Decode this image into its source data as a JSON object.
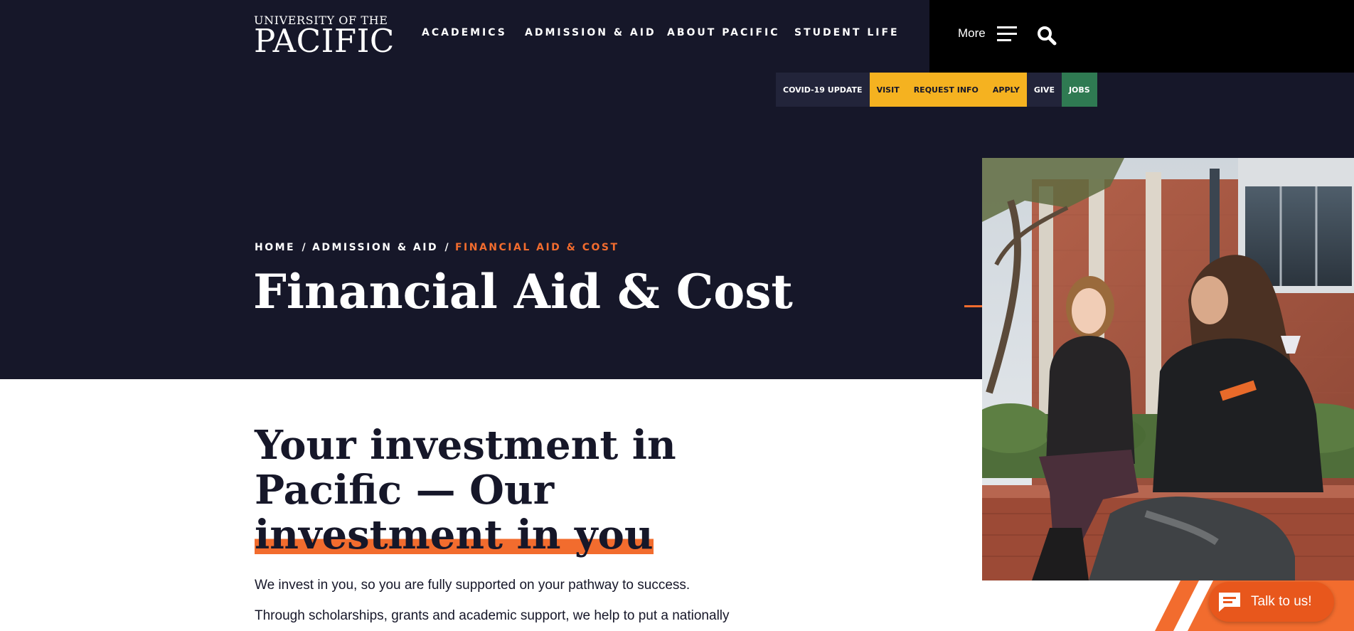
{
  "header": {
    "logo": {
      "top_line": "UNIVERSITY OF THE",
      "main": "PACIFIC"
    },
    "nav": [
      {
        "label": "ACADEMICS"
      },
      {
        "label": "ADMISSION & AID"
      },
      {
        "label": "ABOUT PACIFIC"
      },
      {
        "label": "STUDENT LIFE"
      }
    ],
    "more_label": "More",
    "icons": {
      "menu": "hamburger-menu-icon",
      "search": "search-icon"
    }
  },
  "utility_bar": [
    {
      "label": "COVID-19 UPDATE",
      "style": "dark"
    },
    {
      "label": "VISIT",
      "style": "yellow"
    },
    {
      "label": "REQUEST INFO",
      "style": "yellow"
    },
    {
      "label": "APPLY",
      "style": "yellow"
    },
    {
      "label": "GIVE",
      "style": "dark"
    },
    {
      "label": "JOBS",
      "style": "green"
    }
  ],
  "breadcrumb": {
    "home": "HOME",
    "section": "ADMISSION & AID",
    "current": "FINANCIAL AID & COST",
    "separator": "/"
  },
  "page_title": "Financial Aid & Cost",
  "intro": {
    "heading_lines": [
      "Your investment in",
      "Pacific — Our",
      "investment in you"
    ],
    "paragraphs": [
      "We invest in you, so you are fully supported on your pathway to success.",
      "Through scholarships, grants and academic support, we help to put a nationally"
    ]
  },
  "hero_image": {
    "alt": "Two students sitting and talking on a brick ledge outside a campus building"
  },
  "chat": {
    "label": "Talk to us!",
    "icon": "chat-bubble-icon"
  },
  "colors": {
    "navy": "#161729",
    "black": "#000000",
    "orange": "#f26c2e",
    "yellow": "#f5b220",
    "green": "#2f7a52",
    "chat_orange": "#e8571c"
  }
}
